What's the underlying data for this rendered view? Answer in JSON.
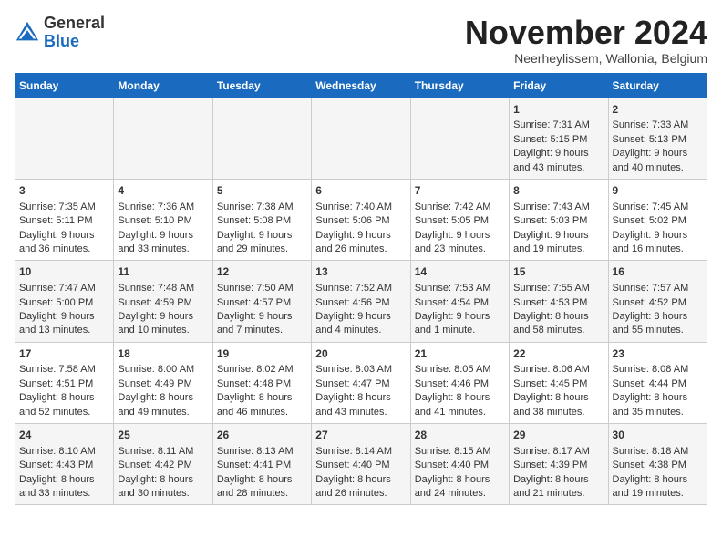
{
  "header": {
    "logo_general": "General",
    "logo_blue": "Blue",
    "month_title": "November 2024",
    "subtitle": "Neerheylissem, Wallonia, Belgium"
  },
  "days_of_week": [
    "Sunday",
    "Monday",
    "Tuesday",
    "Wednesday",
    "Thursday",
    "Friday",
    "Saturday"
  ],
  "weeks": [
    [
      {
        "day": "",
        "sunrise": "",
        "sunset": "",
        "daylight": ""
      },
      {
        "day": "",
        "sunrise": "",
        "sunset": "",
        "daylight": ""
      },
      {
        "day": "",
        "sunrise": "",
        "sunset": "",
        "daylight": ""
      },
      {
        "day": "",
        "sunrise": "",
        "sunset": "",
        "daylight": ""
      },
      {
        "day": "",
        "sunrise": "",
        "sunset": "",
        "daylight": ""
      },
      {
        "day": "1",
        "sunrise": "Sunrise: 7:31 AM",
        "sunset": "Sunset: 5:15 PM",
        "daylight": "Daylight: 9 hours and 43 minutes."
      },
      {
        "day": "2",
        "sunrise": "Sunrise: 7:33 AM",
        "sunset": "Sunset: 5:13 PM",
        "daylight": "Daylight: 9 hours and 40 minutes."
      }
    ],
    [
      {
        "day": "3",
        "sunrise": "Sunrise: 7:35 AM",
        "sunset": "Sunset: 5:11 PM",
        "daylight": "Daylight: 9 hours and 36 minutes."
      },
      {
        "day": "4",
        "sunrise": "Sunrise: 7:36 AM",
        "sunset": "Sunset: 5:10 PM",
        "daylight": "Daylight: 9 hours and 33 minutes."
      },
      {
        "day": "5",
        "sunrise": "Sunrise: 7:38 AM",
        "sunset": "Sunset: 5:08 PM",
        "daylight": "Daylight: 9 hours and 29 minutes."
      },
      {
        "day": "6",
        "sunrise": "Sunrise: 7:40 AM",
        "sunset": "Sunset: 5:06 PM",
        "daylight": "Daylight: 9 hours and 26 minutes."
      },
      {
        "day": "7",
        "sunrise": "Sunrise: 7:42 AM",
        "sunset": "Sunset: 5:05 PM",
        "daylight": "Daylight: 9 hours and 23 minutes."
      },
      {
        "day": "8",
        "sunrise": "Sunrise: 7:43 AM",
        "sunset": "Sunset: 5:03 PM",
        "daylight": "Daylight: 9 hours and 19 minutes."
      },
      {
        "day": "9",
        "sunrise": "Sunrise: 7:45 AM",
        "sunset": "Sunset: 5:02 PM",
        "daylight": "Daylight: 9 hours and 16 minutes."
      }
    ],
    [
      {
        "day": "10",
        "sunrise": "Sunrise: 7:47 AM",
        "sunset": "Sunset: 5:00 PM",
        "daylight": "Daylight: 9 hours and 13 minutes."
      },
      {
        "day": "11",
        "sunrise": "Sunrise: 7:48 AM",
        "sunset": "Sunset: 4:59 PM",
        "daylight": "Daylight: 9 hours and 10 minutes."
      },
      {
        "day": "12",
        "sunrise": "Sunrise: 7:50 AM",
        "sunset": "Sunset: 4:57 PM",
        "daylight": "Daylight: 9 hours and 7 minutes."
      },
      {
        "day": "13",
        "sunrise": "Sunrise: 7:52 AM",
        "sunset": "Sunset: 4:56 PM",
        "daylight": "Daylight: 9 hours and 4 minutes."
      },
      {
        "day": "14",
        "sunrise": "Sunrise: 7:53 AM",
        "sunset": "Sunset: 4:54 PM",
        "daylight": "Daylight: 9 hours and 1 minute."
      },
      {
        "day": "15",
        "sunrise": "Sunrise: 7:55 AM",
        "sunset": "Sunset: 4:53 PM",
        "daylight": "Daylight: 8 hours and 58 minutes."
      },
      {
        "day": "16",
        "sunrise": "Sunrise: 7:57 AM",
        "sunset": "Sunset: 4:52 PM",
        "daylight": "Daylight: 8 hours and 55 minutes."
      }
    ],
    [
      {
        "day": "17",
        "sunrise": "Sunrise: 7:58 AM",
        "sunset": "Sunset: 4:51 PM",
        "daylight": "Daylight: 8 hours and 52 minutes."
      },
      {
        "day": "18",
        "sunrise": "Sunrise: 8:00 AM",
        "sunset": "Sunset: 4:49 PM",
        "daylight": "Daylight: 8 hours and 49 minutes."
      },
      {
        "day": "19",
        "sunrise": "Sunrise: 8:02 AM",
        "sunset": "Sunset: 4:48 PM",
        "daylight": "Daylight: 8 hours and 46 minutes."
      },
      {
        "day": "20",
        "sunrise": "Sunrise: 8:03 AM",
        "sunset": "Sunset: 4:47 PM",
        "daylight": "Daylight: 8 hours and 43 minutes."
      },
      {
        "day": "21",
        "sunrise": "Sunrise: 8:05 AM",
        "sunset": "Sunset: 4:46 PM",
        "daylight": "Daylight: 8 hours and 41 minutes."
      },
      {
        "day": "22",
        "sunrise": "Sunrise: 8:06 AM",
        "sunset": "Sunset: 4:45 PM",
        "daylight": "Daylight: 8 hours and 38 minutes."
      },
      {
        "day": "23",
        "sunrise": "Sunrise: 8:08 AM",
        "sunset": "Sunset: 4:44 PM",
        "daylight": "Daylight: 8 hours and 35 minutes."
      }
    ],
    [
      {
        "day": "24",
        "sunrise": "Sunrise: 8:10 AM",
        "sunset": "Sunset: 4:43 PM",
        "daylight": "Daylight: 8 hours and 33 minutes."
      },
      {
        "day": "25",
        "sunrise": "Sunrise: 8:11 AM",
        "sunset": "Sunset: 4:42 PM",
        "daylight": "Daylight: 8 hours and 30 minutes."
      },
      {
        "day": "26",
        "sunrise": "Sunrise: 8:13 AM",
        "sunset": "Sunset: 4:41 PM",
        "daylight": "Daylight: 8 hours and 28 minutes."
      },
      {
        "day": "27",
        "sunrise": "Sunrise: 8:14 AM",
        "sunset": "Sunset: 4:40 PM",
        "daylight": "Daylight: 8 hours and 26 minutes."
      },
      {
        "day": "28",
        "sunrise": "Sunrise: 8:15 AM",
        "sunset": "Sunset: 4:40 PM",
        "daylight": "Daylight: 8 hours and 24 minutes."
      },
      {
        "day": "29",
        "sunrise": "Sunrise: 8:17 AM",
        "sunset": "Sunset: 4:39 PM",
        "daylight": "Daylight: 8 hours and 21 minutes."
      },
      {
        "day": "30",
        "sunrise": "Sunrise: 8:18 AM",
        "sunset": "Sunset: 4:38 PM",
        "daylight": "Daylight: 8 hours and 19 minutes."
      }
    ]
  ]
}
